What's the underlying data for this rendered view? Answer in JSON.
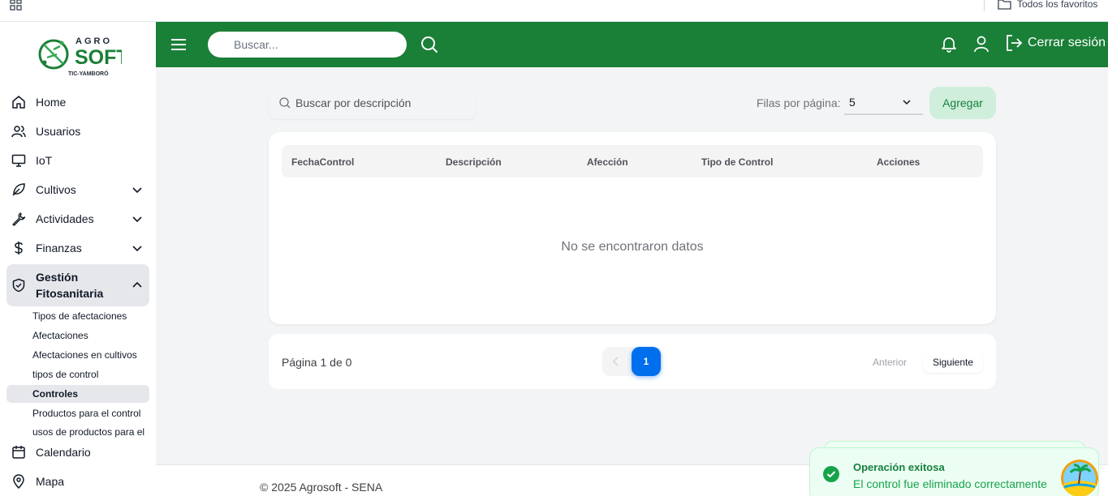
{
  "browser": {
    "favorites_label": "Todos los favoritos"
  },
  "brand": {
    "logo_top": "AGRO",
    "logo_main": "SOFT",
    "logo_sub": "TIC-YAMBORÓ",
    "green": "#1a7f37"
  },
  "sidebar": {
    "items": [
      {
        "label": "Home",
        "icon": "home-icon"
      },
      {
        "label": "Usuarios",
        "icon": "users-icon"
      },
      {
        "label": "IoT",
        "icon": "monitor-icon"
      },
      {
        "label": "Cultivos",
        "icon": "leaf-icon"
      },
      {
        "label": "Actividades",
        "icon": "wrench-icon"
      },
      {
        "label": "Finanzas",
        "icon": "dollar-icon"
      },
      {
        "label": "Gestión Fitosanitaria",
        "icon": "shield-check-icon"
      },
      {
        "label": "Calendario",
        "icon": "calendar-icon"
      },
      {
        "label": "Mapa",
        "icon": "map-pin-icon"
      }
    ],
    "subitems": [
      "Tipos de afectaciones",
      "Afectaciones",
      "Afectaciones en cultivos",
      "tipos de control",
      "Controles",
      "Productos para el control",
      "usos de productos para el"
    ]
  },
  "header": {
    "search_placeholder": "Buscar...",
    "logout_label": "Cerrar sesión"
  },
  "toolbar": {
    "search_placeholder": "Buscar por descripción",
    "rows_label": "Filas por página:",
    "rows_value": "5",
    "add_label": "Agregar"
  },
  "table": {
    "columns": [
      "FechaControl",
      "Descripción",
      "Afección",
      "Tipo de Control",
      "Acciones"
    ],
    "empty_message": "No se encontraron datos"
  },
  "pagination": {
    "info": "Página 1 de 0",
    "current_page": "1",
    "prev_label": "Anterior",
    "next_label": "Siguiente"
  },
  "footer": {
    "text": "© 2025 Agrosoft - SENA"
  },
  "toast": {
    "title": "Operación exitosa",
    "message": "El control fue eliminado correctamente"
  }
}
